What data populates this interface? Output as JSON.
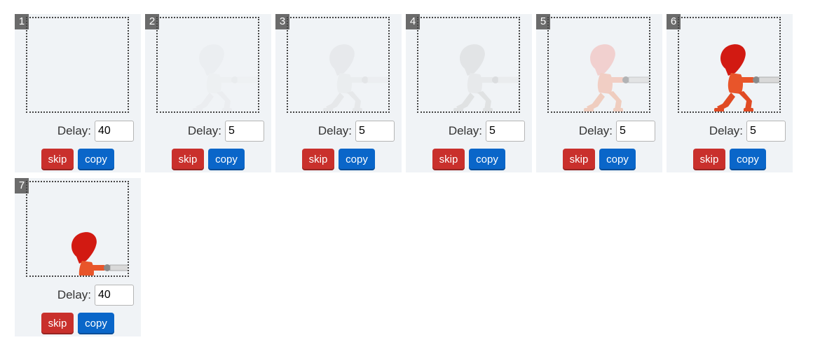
{
  "frames": [
    {
      "number": "1",
      "delay_label": "Delay:",
      "delay": "40",
      "skip_label": "skip",
      "copy_label": "copy",
      "opacity": 0,
      "color": "ghost"
    },
    {
      "number": "2",
      "delay_label": "Delay:",
      "delay": "5",
      "skip_label": "skip",
      "copy_label": "copy",
      "opacity": 0.12,
      "color": "ghost"
    },
    {
      "number": "3",
      "delay_label": "Delay:",
      "delay": "5",
      "skip_label": "skip",
      "copy_label": "copy",
      "opacity": 0.25,
      "color": "ghost"
    },
    {
      "number": "4",
      "delay_label": "Delay:",
      "delay": "5",
      "skip_label": "skip",
      "copy_label": "copy",
      "opacity": 0.4,
      "color": "ghost"
    },
    {
      "number": "5",
      "delay_label": "Delay:",
      "delay": "5",
      "skip_label": "skip",
      "copy_label": "copy",
      "opacity": 0.6,
      "color": "pink"
    },
    {
      "number": "6",
      "delay_label": "Delay:",
      "delay": "5",
      "skip_label": "skip",
      "copy_label": "copy",
      "opacity": 1,
      "color": "full"
    },
    {
      "number": "7",
      "delay_label": "Delay:",
      "delay": "40",
      "skip_label": "skip",
      "copy_label": "copy",
      "opacity": 1,
      "color": "full"
    }
  ],
  "colors": {
    "panel": "#f0f3f6",
    "skip": "#c9302c",
    "copy": "#0a66c9",
    "number_badge": "#6b6b6b",
    "character_hair": "#d21a12",
    "character_body": "#e8552a",
    "blade": "#d9d9d9"
  }
}
